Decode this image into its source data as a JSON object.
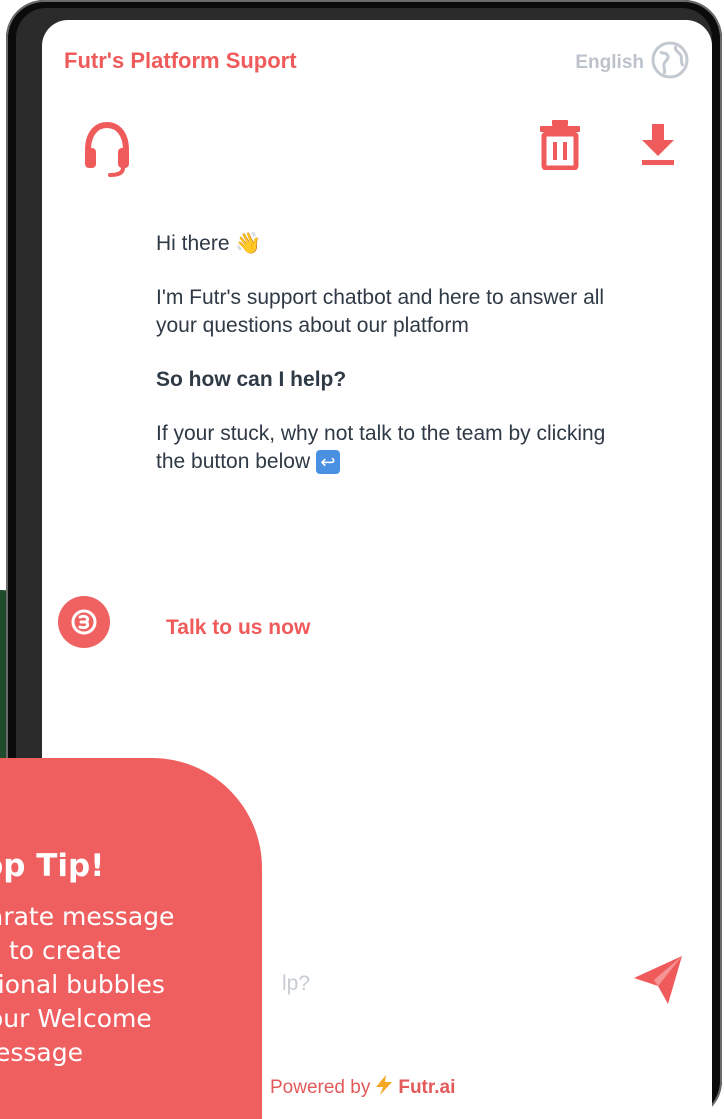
{
  "header": {
    "title": "Futr's Platform Suport",
    "language": "English"
  },
  "toolbar": {
    "support_icon": "headset-icon",
    "delete_icon": "trash-icon",
    "download_icon": "download-icon"
  },
  "messages": {
    "greeting": "Hi there",
    "greeting_emoji": "👋",
    "intro": "I'm Futr's support chatbot and here to answer all your questions about our platform",
    "question": "So how can I help?",
    "stuck_text": "If your stuck, why not talk to the team by clicking the button below",
    "stuck_emoji": "↩"
  },
  "talk_link": "Talk to us now",
  "input": {
    "placeholder_fragment": "lp?"
  },
  "footer": {
    "powered_label": "Powered by",
    "brand": "Futr.ai"
  },
  "tip": {
    "title": "op Tip!",
    "lines": [
      "arate message",
      "s to create",
      "tional bubbles",
      "our Welcome",
      "lessage"
    ]
  },
  "colors": {
    "accent": "#ef5b5b",
    "text": "#2f3a46",
    "muted": "#c7ccd2",
    "tip_bg": "#ef5f60"
  }
}
